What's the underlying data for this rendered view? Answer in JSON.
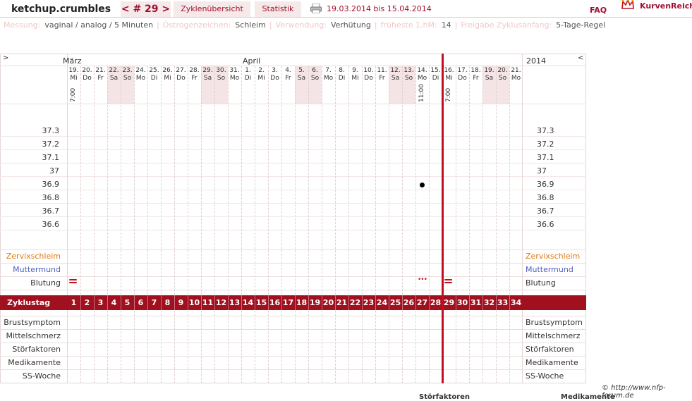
{
  "topbar": {
    "user": "ketchup.crumbles",
    "cycle": "< # 29 >",
    "overview": "Zyklenübersicht",
    "stats": "Statistik",
    "range": "19.03.2014 bis 15.04.2014",
    "faq": "FAQ",
    "brand": "KurvenReich"
  },
  "settings": [
    {
      "label": "Messung:",
      "value": "vaginal / analog / 5 Minuten"
    },
    {
      "label": "Östrogenzeichen:",
      "value": "Schleim"
    },
    {
      "label": "Verwendung:",
      "value": "Verhütung"
    },
    {
      "label": "früheste 1.hM:",
      "value": "14"
    },
    {
      "label": "Freigabe Zyklusanfang:",
      "value": "5-Tage-Regel"
    }
  ],
  "chart": {
    "nav_left": ">",
    "nav_right": "<",
    "month_march": "März",
    "month_april": "April",
    "year": "2014",
    "days": [
      {
        "d": "19.",
        "w": "Mi",
        "time": "7:00"
      },
      {
        "d": "20.",
        "w": "Do"
      },
      {
        "d": "21.",
        "w": "Fr"
      },
      {
        "d": "22.",
        "w": "Sa"
      },
      {
        "d": "23.",
        "w": "So"
      },
      {
        "d": "24.",
        "w": "Mo"
      },
      {
        "d": "25.",
        "w": "Di"
      },
      {
        "d": "26.",
        "w": "Mi"
      },
      {
        "d": "27.",
        "w": "Do"
      },
      {
        "d": "28.",
        "w": "Fr"
      },
      {
        "d": "29.",
        "w": "Sa"
      },
      {
        "d": "30.",
        "w": "So"
      },
      {
        "d": "31.",
        "w": "Mo"
      },
      {
        "d": "1.",
        "w": "Di"
      },
      {
        "d": "2.",
        "w": "Mi"
      },
      {
        "d": "3.",
        "w": "Do"
      },
      {
        "d": "4.",
        "w": "Fr"
      },
      {
        "d": "5.",
        "w": "Sa"
      },
      {
        "d": "6.",
        "w": "So"
      },
      {
        "d": "7.",
        "w": "Mo"
      },
      {
        "d": "8.",
        "w": "Di"
      },
      {
        "d": "9.",
        "w": "Mi"
      },
      {
        "d": "10.",
        "w": "Do"
      },
      {
        "d": "11.",
        "w": "Fr"
      },
      {
        "d": "12.",
        "w": "Sa"
      },
      {
        "d": "13.",
        "w": "So"
      },
      {
        "d": "14.",
        "w": "Mo",
        "time": "11:00"
      },
      {
        "d": "15.",
        "w": "Di"
      },
      {
        "d": "16.",
        "w": "Mi",
        "time": "7:00"
      },
      {
        "d": "17.",
        "w": "Do"
      },
      {
        "d": "18.",
        "w": "Fr"
      },
      {
        "d": "19.",
        "w": "Sa"
      },
      {
        "d": "20.",
        "w": "So"
      },
      {
        "d": "21.",
        "w": "Mo"
      }
    ],
    "temps": [
      "37.3",
      "37.2",
      "37.1",
      "37",
      "36.9",
      "36.8",
      "36.7",
      "36.6"
    ],
    "temp_reading": {
      "day_index": 26,
      "value": 36.9
    },
    "rows_top": {
      "cervix": "Zervixschleim",
      "os": "Muttermund",
      "bleeding": "Blutung"
    },
    "bleeding_marks": [
      {
        "day_index": 0,
        "kind": "heavy"
      },
      {
        "day_index": 26,
        "kind": "spotting",
        "symbol": "•••"
      },
      {
        "day_index": 28,
        "kind": "heavy"
      }
    ],
    "cycle_label": "Zyklustag",
    "cycle_days": [
      "1",
      "2",
      "3",
      "4",
      "5",
      "6",
      "7",
      "8",
      "9",
      "10",
      "11",
      "12",
      "13",
      "14",
      "15",
      "16",
      "17",
      "18",
      "19",
      "20",
      "21",
      "22",
      "23",
      "24",
      "25",
      "26",
      "27",
      "28",
      "29",
      "30",
      "31",
      "32",
      "33",
      "34"
    ],
    "rows_bottom": [
      "Brustsymptom",
      "Mittelschmerz",
      "Störfaktoren",
      "Medikamente",
      "SS-Woche"
    ]
  },
  "footer": {
    "credit": "© http://www.nfp-forum.de",
    "cut_left": "Störfaktoren",
    "cut_right": "Medikamente"
  },
  "colors": {
    "accent": "#a0101e",
    "weekend": "#f5e4e6",
    "cervix": "#e07810",
    "os": "#5060c0"
  }
}
